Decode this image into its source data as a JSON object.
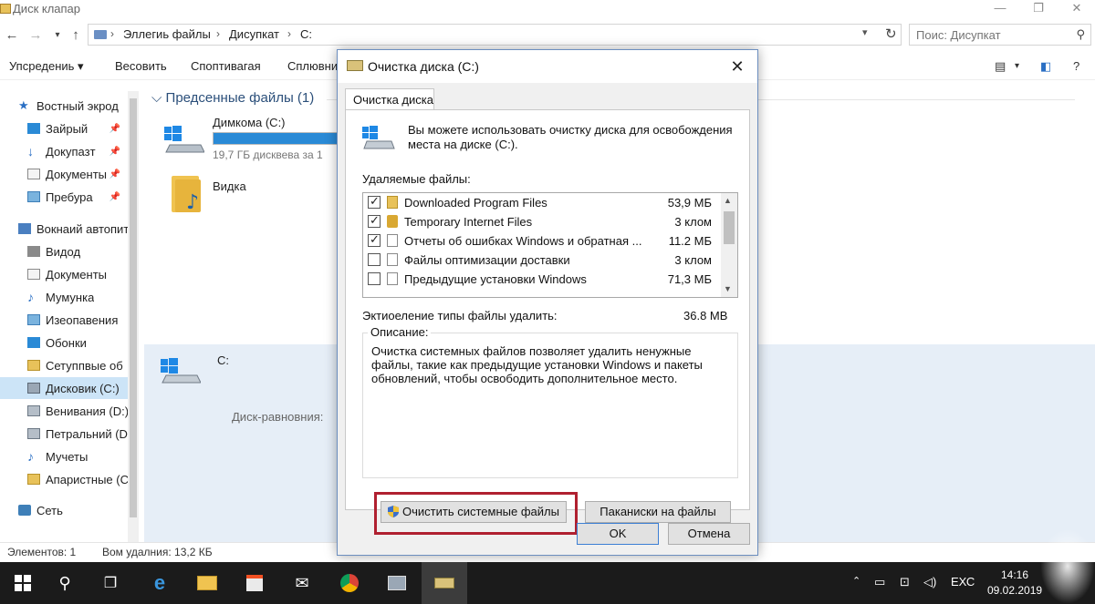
{
  "window": {
    "title": "Диск клапар",
    "min": "—",
    "max": "❐",
    "close": "✕"
  },
  "address": {
    "crumbs": [
      "Эллегиь файлы",
      "Дисупкат",
      "C:"
    ],
    "search_placeholder": "Поис: Дисупкат"
  },
  "toolbar": {
    "items": [
      "Упсредениь ▾",
      "Весовить",
      "Споптивагая",
      "Сплювни"
    ]
  },
  "sidebar": {
    "items": [
      {
        "label": "Востный экрод",
        "icon": "star-icon",
        "pinned": false
      },
      {
        "label": "Зайрый",
        "icon": "desktop-icon",
        "pinned": true
      },
      {
        "label": "Докупазт",
        "icon": "download-icon",
        "pinned": true
      },
      {
        "label": "Документы",
        "icon": "documents-icon",
        "pinned": true
      },
      {
        "label": "Пребура",
        "icon": "pictures-icon",
        "pinned": true
      },
      {
        "label": "Вокнаий автопит",
        "icon": "computer-icon",
        "pinned": false
      },
      {
        "label": "Видод",
        "icon": "video-icon",
        "pinned": false
      },
      {
        "label": "Документы",
        "icon": "documents-icon",
        "pinned": false
      },
      {
        "label": "Мумунка",
        "icon": "music-icon",
        "pinned": false
      },
      {
        "label": "Изеопавения",
        "icon": "pictures-icon",
        "pinned": false
      },
      {
        "label": "Обонки",
        "icon": "desktop-icon",
        "pinned": false
      },
      {
        "label": "Сетуппвые об",
        "icon": "folder-icon",
        "pinned": false
      },
      {
        "label": "Дисковик (C:)",
        "icon": "drive-icon",
        "pinned": false,
        "selected": true
      },
      {
        "label": "Венивания (D:)",
        "icon": "drive-icon",
        "pinned": false
      },
      {
        "label": "Петральний (D",
        "icon": "drive-icon",
        "pinned": false
      },
      {
        "label": "Мучеты",
        "icon": "music-icon",
        "pinned": false
      },
      {
        "label": "Апаристные (C",
        "icon": "folder-icon",
        "pinned": false
      },
      {
        "label": "Сеть",
        "icon": "network-icon",
        "pinned": false
      }
    ]
  },
  "content": {
    "group_title": "Предсенные файлы (1)",
    "drive": {
      "name": "Димкома (C:)",
      "free_text": "19,7 ГБ дисквева за 1",
      "used_fraction": 0.92
    },
    "folder": {
      "name": "Видка"
    },
    "details": {
      "name": "C:",
      "label": "Диск-равновния:"
    }
  },
  "statusbar": {
    "items": "Элементов: 1",
    "selected": "Вом удалния: 13,2 КБ"
  },
  "dialog": {
    "title": "Очистка диска (C:)",
    "tab": "Очистка диска",
    "intro": "Вы можете использовать очистку диска для освобождения места на диске (C:).",
    "files_label": "Удаляемые файлы:",
    "files": [
      {
        "name": "Downloaded Program Files",
        "size": "53,9 МБ",
        "checked": true,
        "icon": "folder-icon"
      },
      {
        "name": "Temporary Internet Files",
        "size": "3 клом",
        "checked": true,
        "icon": "lock-icon"
      },
      {
        "name": "Отчеты об ошибках Windows и обратная ...",
        "size": "11.2 МБ",
        "checked": true,
        "icon": "file-icon"
      },
      {
        "name": "Файлы оптимизации доставки",
        "size": "3 клом",
        "checked": false,
        "icon": "file-icon"
      },
      {
        "name": "Предыдущие установки Windows",
        "size": "71,3 МБ",
        "checked": false,
        "icon": "file-icon"
      }
    ],
    "total_label": "Эктиоеление типы файлы удалить:",
    "total_value": "36.8 MB",
    "desc_label": "Описание:",
    "desc_text": "Очистка системных файлов позволяет удалить ненужные файлы, такие как предыдущие установки Windows и пакеты обновлений, чтобы освободить дополнительное место.",
    "btn_clean": "Очистить системные файлы",
    "btn_view": "Паканиски на файлы",
    "btn_ok": "OK",
    "btn_cancel": "Отмена"
  },
  "taskbar": {
    "tray_lang": "ЕХС",
    "time": "14:16",
    "date": "09.02.2019"
  },
  "colors": {
    "accent": "#2a8ad6",
    "highlight": "#b02030",
    "taskbar": "#1b1b1b"
  }
}
